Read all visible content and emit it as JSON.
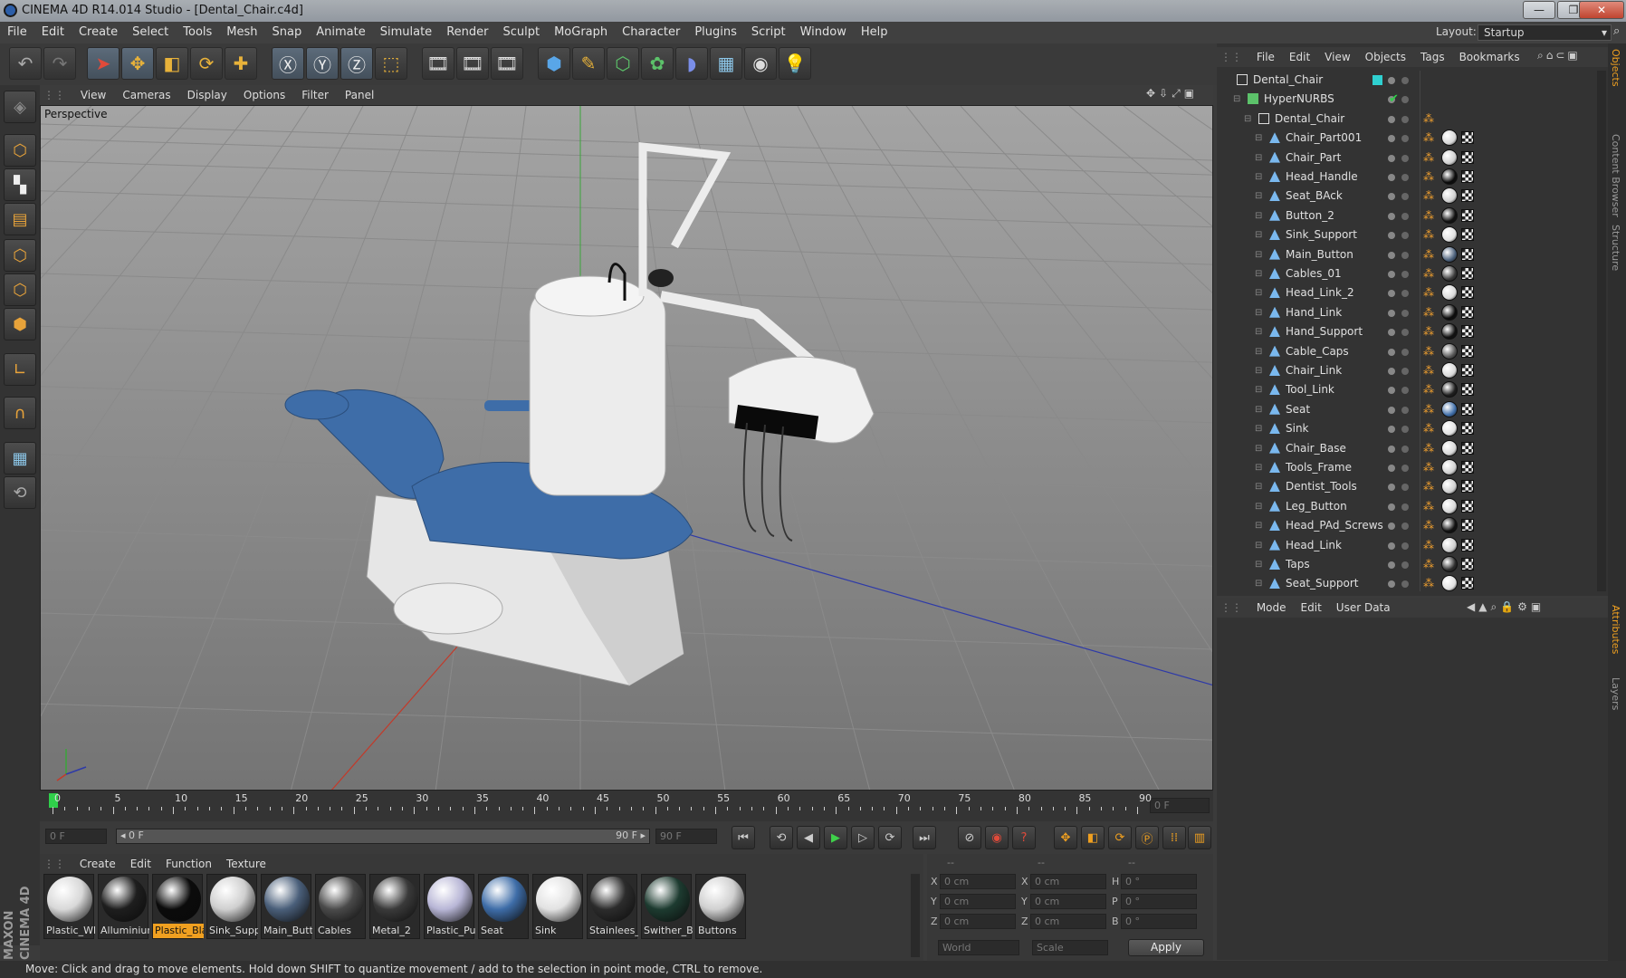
{
  "window": {
    "title": "CINEMA 4D R14.014 Studio - [Dental_Chair.c4d]",
    "minimize": "—",
    "restore": "❐",
    "close": "✕"
  },
  "menu": [
    "File",
    "Edit",
    "Create",
    "Select",
    "Tools",
    "Mesh",
    "Snap",
    "Animate",
    "Simulate",
    "Render",
    "Sculpt",
    "MoGraph",
    "Character",
    "Plugins",
    "Script",
    "Window",
    "Help"
  ],
  "layout": {
    "label": "Layout:",
    "value": "Startup"
  },
  "viewport": {
    "menu": [
      "View",
      "Cameras",
      "Display",
      "Options",
      "Filter",
      "Panel"
    ],
    "label": "Perspective"
  },
  "timeline": {
    "ticks": [
      "0",
      "5",
      "10",
      "15",
      "20",
      "25",
      "30",
      "35",
      "40",
      "45",
      "50",
      "55",
      "60",
      "65",
      "70",
      "75",
      "80",
      "85",
      "90"
    ],
    "current_frame": "0 F",
    "start": "0 F",
    "range_left": "◂ 0 F",
    "range_right": "90 F ▸",
    "end": "90 F"
  },
  "objects": {
    "menu": [
      "File",
      "Edit",
      "View",
      "Objects",
      "Tags",
      "Bookmarks"
    ],
    "items": [
      {
        "name": "Dental_Chair",
        "indent": 0,
        "kind": "null"
      },
      {
        "name": "HyperNURBS",
        "indent": 1,
        "kind": "nurbs"
      },
      {
        "name": "Dental_Chair",
        "indent": 2,
        "kind": "null"
      },
      {
        "name": "Chair_Part001",
        "indent": 3,
        "kind": "poly"
      },
      {
        "name": "Chair_Part",
        "indent": 3,
        "kind": "poly"
      },
      {
        "name": "Head_Handle",
        "indent": 3,
        "kind": "poly"
      },
      {
        "name": "Seat_BAck",
        "indent": 3,
        "kind": "poly"
      },
      {
        "name": "Button_2",
        "indent": 3,
        "kind": "poly"
      },
      {
        "name": "Sink_Support",
        "indent": 3,
        "kind": "poly"
      },
      {
        "name": "Main_Button",
        "indent": 3,
        "kind": "poly"
      },
      {
        "name": "Cables_01",
        "indent": 3,
        "kind": "poly"
      },
      {
        "name": "Head_Link_2",
        "indent": 3,
        "kind": "poly"
      },
      {
        "name": "Hand_Link",
        "indent": 3,
        "kind": "poly"
      },
      {
        "name": "Hand_Support",
        "indent": 3,
        "kind": "poly"
      },
      {
        "name": "Cable_Caps",
        "indent": 3,
        "kind": "poly"
      },
      {
        "name": "Chair_Link",
        "indent": 3,
        "kind": "poly"
      },
      {
        "name": "Tool_Link",
        "indent": 3,
        "kind": "poly"
      },
      {
        "name": "Seat",
        "indent": 3,
        "kind": "poly"
      },
      {
        "name": "Sink",
        "indent": 3,
        "kind": "poly"
      },
      {
        "name": "Chair_Base",
        "indent": 3,
        "kind": "poly"
      },
      {
        "name": "Tools_Frame",
        "indent": 3,
        "kind": "poly"
      },
      {
        "name": "Dentist_Tools",
        "indent": 3,
        "kind": "poly"
      },
      {
        "name": "Leg_Button",
        "indent": 3,
        "kind": "poly"
      },
      {
        "name": "Head_PAd_Screws",
        "indent": 3,
        "kind": "poly"
      },
      {
        "name": "Head_Link",
        "indent": 3,
        "kind": "poly"
      },
      {
        "name": "Taps",
        "indent": 3,
        "kind": "poly"
      },
      {
        "name": "Seat_Support",
        "indent": 3,
        "kind": "poly"
      }
    ]
  },
  "attributes": {
    "menu": [
      "Mode",
      "Edit",
      "User Data"
    ]
  },
  "materials": {
    "menu": [
      "Create",
      "Edit",
      "Function",
      "Texture"
    ],
    "items": [
      {
        "name": "Plastic_Wh",
        "color": "#d8d8d8"
      },
      {
        "name": "Alluminium",
        "color": "#1e1e1e"
      },
      {
        "name": "Plastic_Blac",
        "color": "#0b0b0b",
        "selected": true
      },
      {
        "name": "Sink_Suppo",
        "color": "#cfcfcf"
      },
      {
        "name": "Main_Butto",
        "color": "#4a5f7a"
      },
      {
        "name": "Cables",
        "color": "#4a4a4a"
      },
      {
        "name": "Metal_2",
        "color": "#3a3a3a"
      },
      {
        "name": "Plastic_Purp",
        "color": "#b8b6d6"
      },
      {
        "name": "Seat",
        "color": "#3e6da8"
      },
      {
        "name": "Sink",
        "color": "#e2e2e2"
      },
      {
        "name": "Stainlees_S",
        "color": "#2c2c2c"
      },
      {
        "name": "Swither_Bu",
        "color": "#1d3b30"
      },
      {
        "name": "Buttons",
        "color": "#d0d0d0"
      }
    ]
  },
  "coords": {
    "headers": [
      "--",
      "--",
      "--"
    ],
    "rows": [
      {
        "a": "X",
        "av": "0 cm",
        "b": "X",
        "bv": "0 cm",
        "c": "H",
        "cv": "0 °"
      },
      {
        "a": "Y",
        "av": "0 cm",
        "b": "Y",
        "bv": "0 cm",
        "c": "P",
        "cv": "0 °"
      },
      {
        "a": "Z",
        "av": "0 cm",
        "b": "Z",
        "bv": "0 cm",
        "c": "B",
        "cv": "0 °"
      }
    ],
    "space": "World",
    "mode": "Scale",
    "apply": "Apply"
  },
  "status": "Move: Click and drag to move elements. Hold down SHIFT to quantize movement / add to the selection in point mode, CTRL to remove.",
  "right_tabs": [
    "Objects",
    "Content Browser",
    "Structure",
    "Attributes",
    "Layers"
  ],
  "branding": {
    "maxon": "MAXON",
    "product": "CINEMA 4D"
  },
  "colors": {
    "accent": "#f0a020",
    "seat_blue": "#3e6da8",
    "axis_red": "#c23a2a",
    "axis_green": "#3aa53a",
    "axis_blue": "#2e3aa8"
  }
}
